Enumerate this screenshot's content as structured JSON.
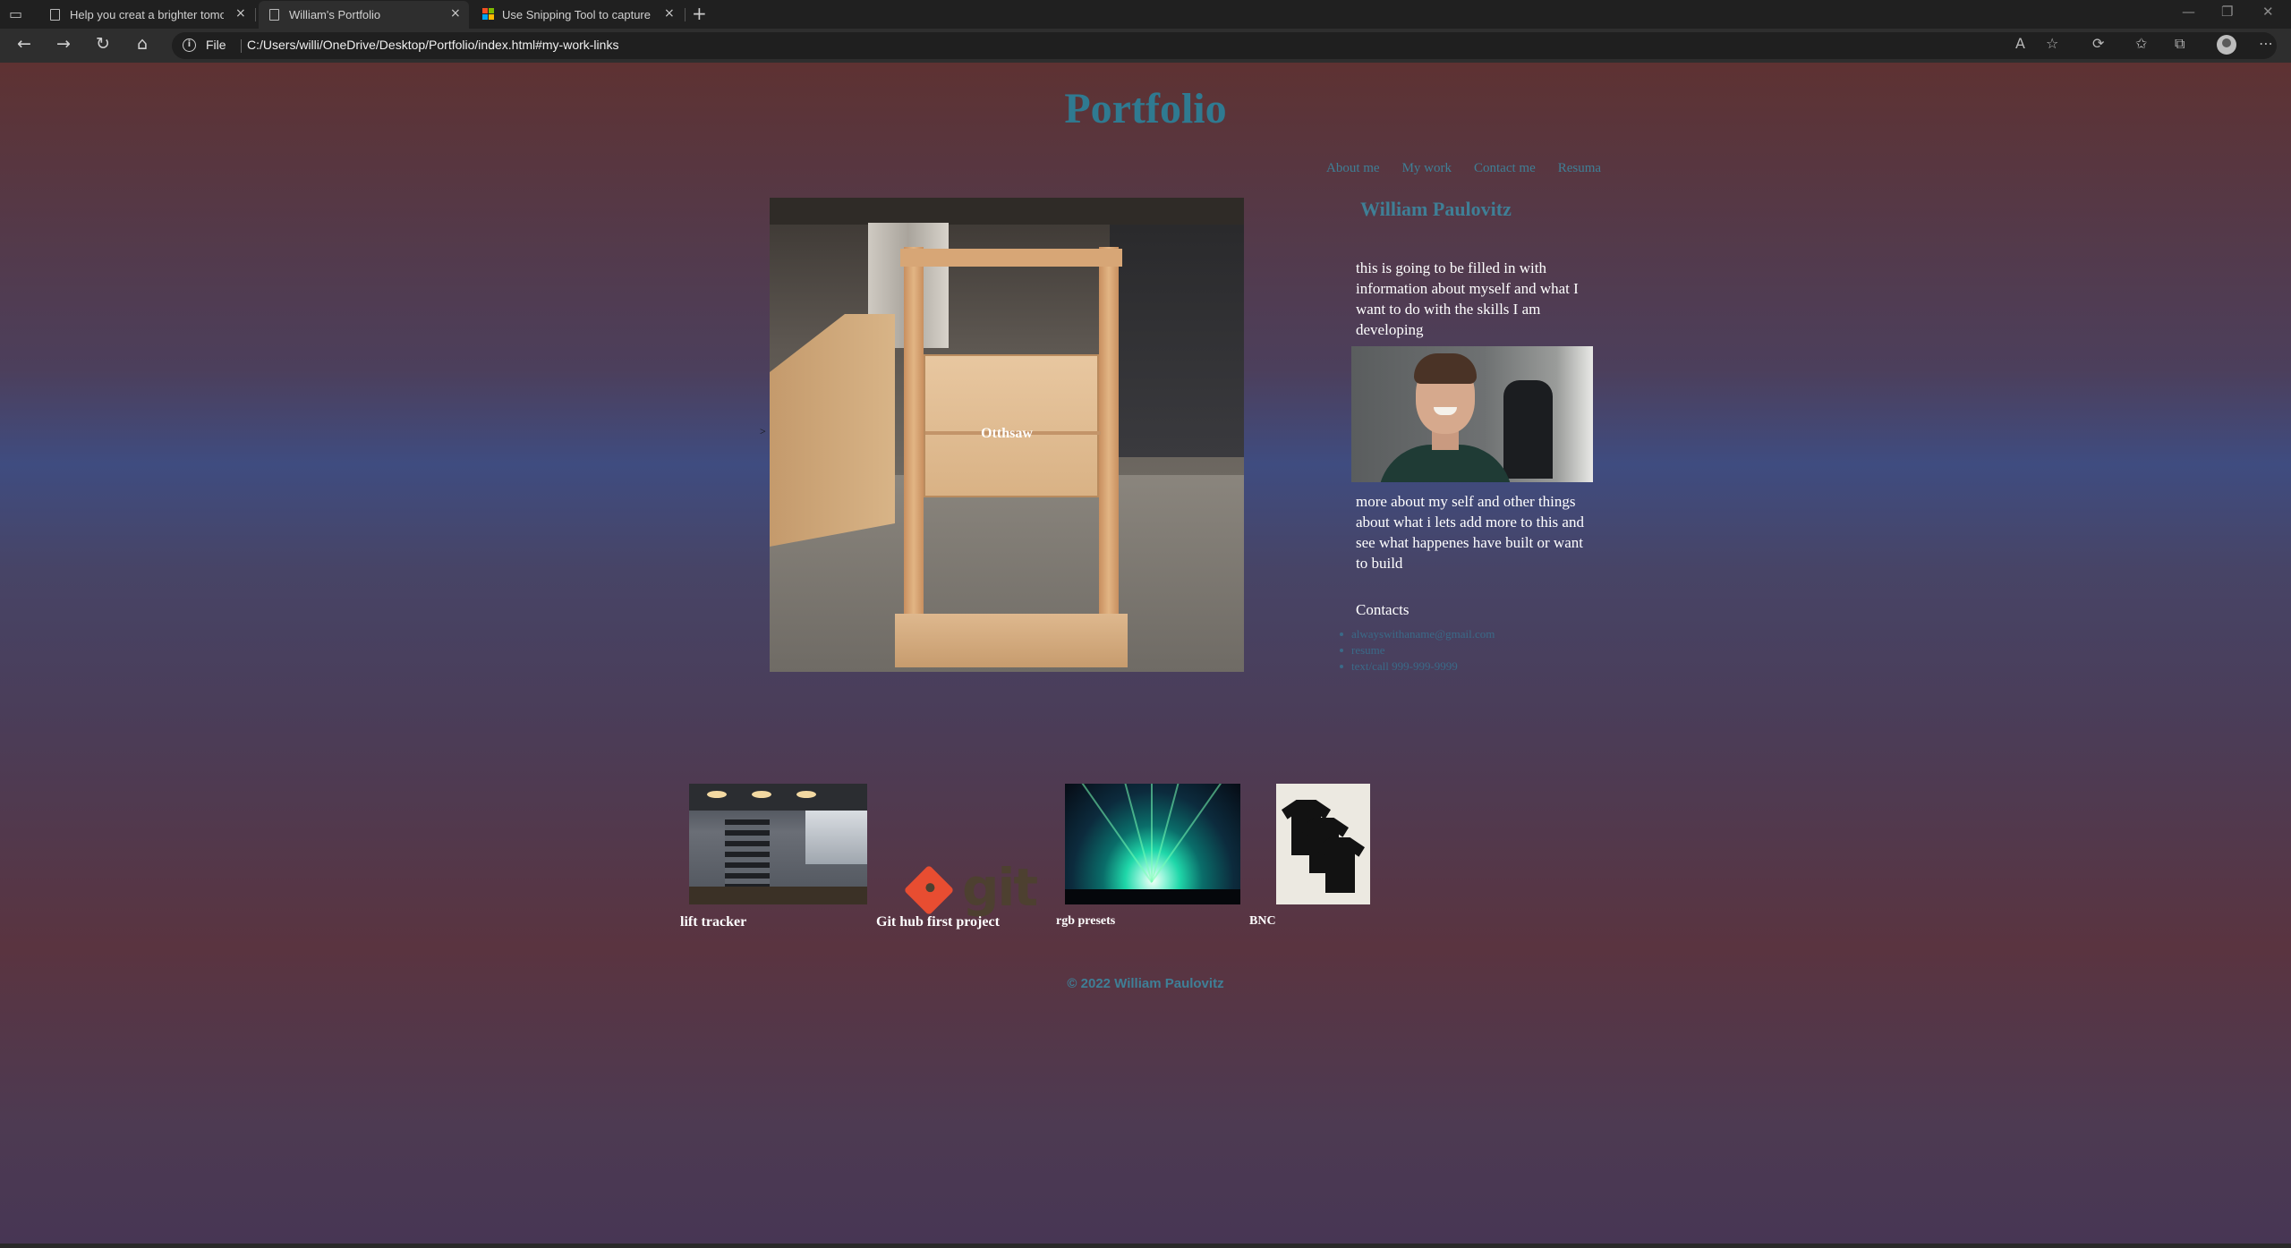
{
  "browser": {
    "tabs": [
      {
        "title": "Help you creat a brighter tomorrow",
        "active": false
      },
      {
        "title": "William's Portfolio",
        "active": true
      },
      {
        "title": "Use Snipping Tool to capture screenshots",
        "active": false
      }
    ],
    "address": {
      "scheme": "File",
      "url": "C:/Users/willi/OneDrive/Desktop/Portfolio/index.html#my-work-links"
    }
  },
  "site": {
    "title": "Portfolio",
    "nav": [
      "About me",
      "My work",
      "Contact me",
      "Resuma"
    ]
  },
  "hero": {
    "caption": "Otthsaw",
    "marker": ">"
  },
  "about": {
    "name": "William Paulovitz",
    "intro": "this is going to be filled in with information about myself and what I want to do with the skills I am developing",
    "more": "more about my self and other things about what i lets add more to this and see what happenes have built or want to build",
    "contacts_heading": "Contacts",
    "contacts": [
      "alwayswithaname@gmail.com",
      "resume",
      "text/call 999-999-9999"
    ]
  },
  "projects": [
    {
      "label": "lift tracker",
      "image": "gym-photo"
    },
    {
      "label": "Git hub first project",
      "image": "git-logo",
      "logo_text": "git"
    },
    {
      "label": "rgb presets",
      "image": "concert-lights-photo"
    },
    {
      "label": "BNC",
      "image": "black-tshirts-photo"
    }
  ],
  "footer": "© 2022 William Paulovitz",
  "colors": {
    "accent": "#3f7f96",
    "git_orange": "#e84d31"
  }
}
